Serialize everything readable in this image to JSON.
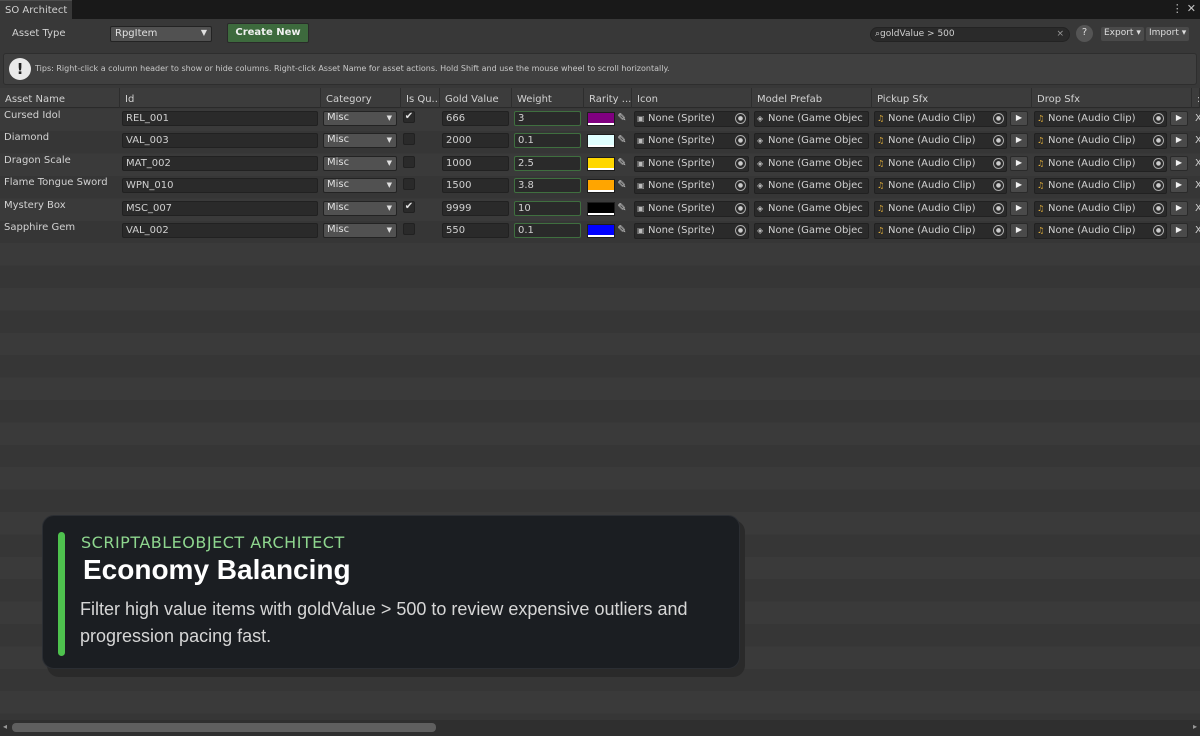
{
  "window": {
    "tab_title": "SO Architect",
    "menu_glyph": "⋮",
    "close_glyph": "✕"
  },
  "toolbar": {
    "asset_type_label": "Asset Type",
    "asset_type_value": "RpgItem",
    "create_label": "Create New",
    "search_value": "goldValue > 500",
    "help_label": "?",
    "export_label": "Export",
    "import_label": "Import"
  },
  "tips": {
    "icon": "!",
    "text": "Tips: Right-click a column header to show or hide columns. Right-click Asset Name for asset actions. Hold Shift and use the mouse wheel to scroll horizontally."
  },
  "columns": [
    "Asset Name",
    "Id",
    "Category",
    "Is Qu...",
    "Gold Value",
    "Weight",
    "Rarity ...",
    "Icon",
    "Model Prefab",
    "Pickup Sfx",
    "Drop Sfx"
  ],
  "rows": [
    {
      "name": "Cursed Idol",
      "id": "REL_001",
      "category": "Misc",
      "quest": true,
      "gold": "666",
      "weight": "3",
      "color": "#800080",
      "icon": "None (Sprite)",
      "prefab": "None (Game Objec",
      "pickup": "None (Audio Clip)",
      "drop": "None (Audio Clip)",
      "x": "X"
    },
    {
      "name": "Diamond",
      "id": "VAL_003",
      "category": "Misc",
      "quest": false,
      "gold": "2000",
      "weight": "0.1",
      "color": "#e0ffff",
      "icon": "None (Sprite)",
      "prefab": "None (Game Objec",
      "pickup": "None (Audio Clip)",
      "drop": "None (Audio Clip)",
      "x": "X"
    },
    {
      "name": "Dragon Scale",
      "id": "MAT_002",
      "category": "Misc",
      "quest": false,
      "gold": "1000",
      "weight": "2.5",
      "color": "#ffd700",
      "icon": "None (Sprite)",
      "prefab": "None (Game Objec",
      "pickup": "None (Audio Clip)",
      "drop": "None (Audio Clip)",
      "x": "X"
    },
    {
      "name": "Flame Tongue Sword",
      "id": "WPN_010",
      "category": "Misc",
      "quest": false,
      "gold": "1500",
      "weight": "3.8",
      "color": "#ffa500",
      "icon": "None (Sprite)",
      "prefab": "None (Game Objec",
      "pickup": "None (Audio Clip)",
      "drop": "None (Audio Clip)",
      "x": "X"
    },
    {
      "name": "Mystery Box",
      "id": "MSC_007",
      "category": "Misc",
      "quest": true,
      "gold": "9999",
      "weight": "10",
      "color": "#000000",
      "icon": "None (Sprite)",
      "prefab": "None (Game Objec",
      "pickup": "None (Audio Clip)",
      "drop": "None (Audio Clip)",
      "x": "X"
    },
    {
      "name": "Sapphire Gem",
      "id": "VAL_002",
      "category": "Misc",
      "quest": false,
      "gold": "550",
      "weight": "0.1",
      "color": "#0000ff",
      "icon": "None (Sprite)",
      "prefab": "None (Game Objec",
      "pickup": "None (Audio Clip)",
      "drop": "None (Audio Clip)",
      "x": "X"
    }
  ],
  "icons": {
    "sprite": "sprite-icon",
    "prefab": "prefab-icon",
    "audio": "audio-clip-icon",
    "target": "object-picker-icon",
    "eyedropper": "eyedropper-icon",
    "play": "play-icon"
  },
  "colors": {
    "accent_green": "#4ec24e",
    "create_button": "#3d6a3d",
    "kicker": "#8ed68e"
  },
  "overlay": {
    "kicker": "SCRIPTABLEOBJECT ARCHITECT",
    "title": "Economy Balancing",
    "description": "Filter high value items with goldValue > 500 to review expensive outliers and progression pacing fast."
  }
}
